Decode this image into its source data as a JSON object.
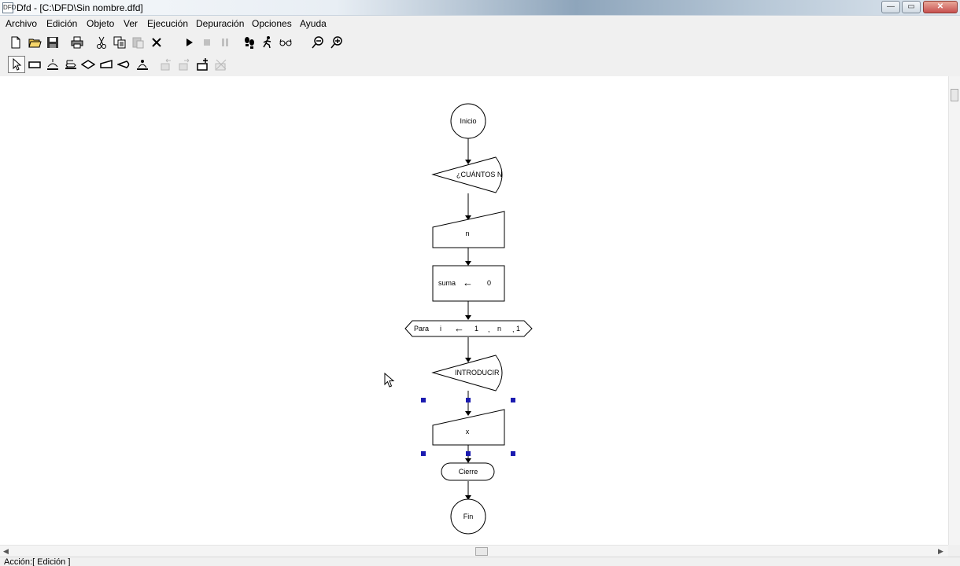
{
  "window": {
    "icon_label": "DFD",
    "title": "Dfd - [C:\\DFD\\Sin nombre.dfd]",
    "min_glyph": "—",
    "max_glyph": "▭",
    "close_glyph": "✕"
  },
  "menu": [
    "Archivo",
    "Edición",
    "Objeto",
    "Ver",
    "Ejecución",
    "Depuración",
    "Opciones",
    "Ayuda"
  ],
  "toolbar_main": [
    {
      "icon": "new-file-icon"
    },
    {
      "icon": "open-folder-icon"
    },
    {
      "icon": "save-icon"
    },
    {
      "icon": "print-icon"
    },
    {
      "icon": "cut-icon"
    },
    {
      "icon": "copy-icon"
    },
    {
      "icon": "paste-icon"
    },
    {
      "icon": "delete-icon"
    },
    {
      "icon": "run-icon"
    },
    {
      "icon": "stop-icon"
    },
    {
      "icon": "pause-icon"
    },
    {
      "icon": "step-icon"
    },
    {
      "icon": "run-step-icon"
    },
    {
      "icon": "watch-icon"
    },
    {
      "icon": "zoom-out-icon"
    },
    {
      "icon": "zoom-in-icon"
    }
  ],
  "toolbar_objects": [
    {
      "icon": "pointer-icon"
    },
    {
      "icon": "assignment-icon"
    },
    {
      "icon": "loop-while-icon"
    },
    {
      "icon": "loop-for-icon"
    },
    {
      "icon": "decision-icon"
    },
    {
      "icon": "read-icon"
    },
    {
      "icon": "write-icon"
    },
    {
      "icon": "subprogram-icon"
    },
    {
      "icon": "subprogram-prev-icon"
    },
    {
      "icon": "subprogram-next-icon"
    },
    {
      "icon": "subprogram-new-icon"
    },
    {
      "icon": "subprogram-delete-icon"
    }
  ],
  "flowchart": {
    "start_label": "Inicio",
    "output1_text": "¿CUÁNTOS N",
    "read1_var": "n",
    "assign_var": "suma",
    "assign_arrow": "←",
    "assign_value": "0",
    "for_keyword": "Para",
    "for_var": "i",
    "for_arrow": "←",
    "for_start": "1",
    "for_end": "n",
    "for_step": "1",
    "for_sep1": ",",
    "for_sep2": ",",
    "output2_text": "INTRODUCIR",
    "read2_var": "x",
    "close_label": "Cierre",
    "end_label": "Fin"
  },
  "scroll_arrows": {
    "left": "◀",
    "right": "▶"
  },
  "status": "Acción:[ Edición ]"
}
